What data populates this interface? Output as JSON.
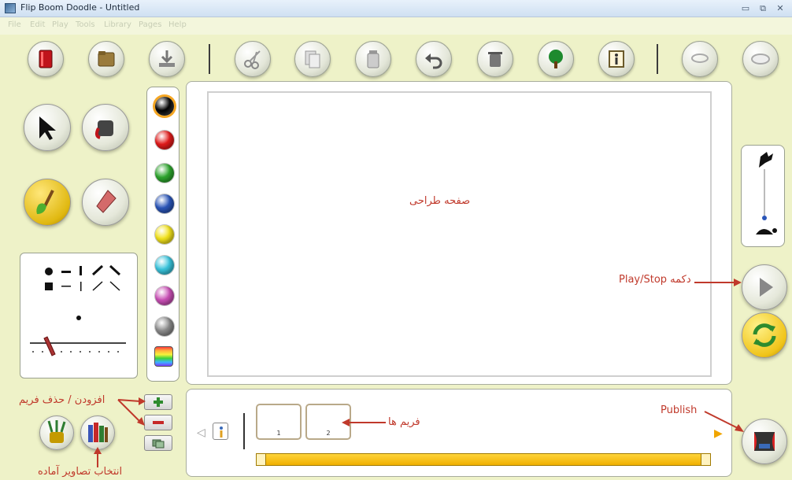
{
  "window": {
    "title": "Flip Boom Doodle - Untitled",
    "controls": {
      "minimize": "▭",
      "maximize": "⧉",
      "close": "✕"
    }
  },
  "menu": [
    "File",
    "Edit",
    "Play",
    "Tools",
    "Library",
    "Pages",
    "Help"
  ],
  "toolbar": {
    "icons": [
      "book-icon",
      "folder-icon",
      "download-icon",
      "scissors-icon",
      "copy-icon",
      "paste-icon",
      "undo-icon",
      "trash-icon",
      "tree-icon",
      "info-icon",
      "lasso-icon",
      "onion-skin-icon"
    ]
  },
  "palette": {
    "colors": [
      "#000000",
      "#e11b1b",
      "#2da52d",
      "#2a55b8",
      "#f2e21c",
      "#39c4dc",
      "#c94fb5",
      "#8a8a8a"
    ],
    "rainbow_swatch": "rainbow"
  },
  "annotations": {
    "canvas": "صفحه طراحی",
    "play_stop": "دکمه Play/Stop",
    "frames": "فریم ها",
    "add_delete": "افزودن / حذف فریم",
    "ready_images": "انتخاب تصاویر آماده",
    "publish": "Publish"
  },
  "frames": [
    "1",
    "2"
  ],
  "colors": {
    "annotation": "#c0392b",
    "background": "#eef2c8",
    "timeline": "#f5c400"
  }
}
